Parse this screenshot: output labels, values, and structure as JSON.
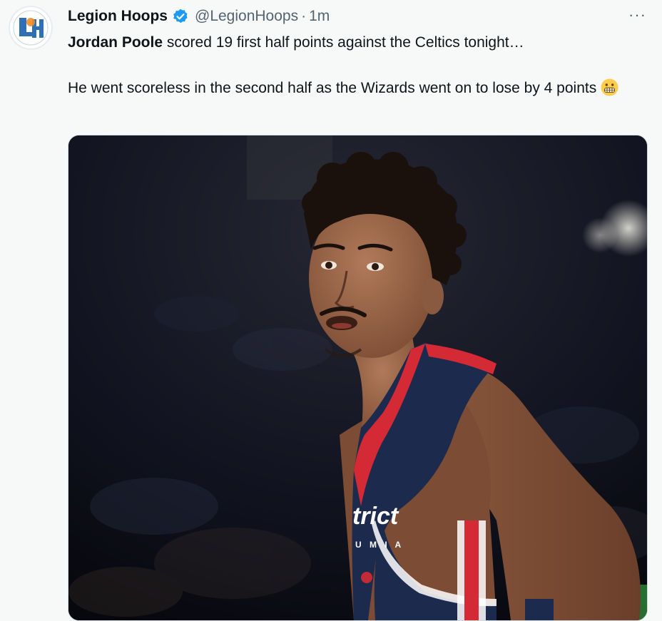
{
  "author": {
    "display_name": "Legion Hoops",
    "handle": "@LegionHoops",
    "separator": "·",
    "time": "1m",
    "avatar_text": "LH",
    "verified": true
  },
  "more_label": "···",
  "tweet": {
    "mention": "Jordan Poole",
    "line1_rest": " scored 19 first half points against the Celtics tonight…",
    "line2": "He went scoreless in the second half as the Wizards went on to lose by 4 points",
    "emoji": "grimacing-face-emoji"
  },
  "media": {
    "jersey_text": "trict",
    "jersey_subtext": "U M I A"
  },
  "colors": {
    "verified": "#1d9bf0",
    "jersey_navy": "#1b2a4d",
    "jersey_red": "#d42a35"
  }
}
